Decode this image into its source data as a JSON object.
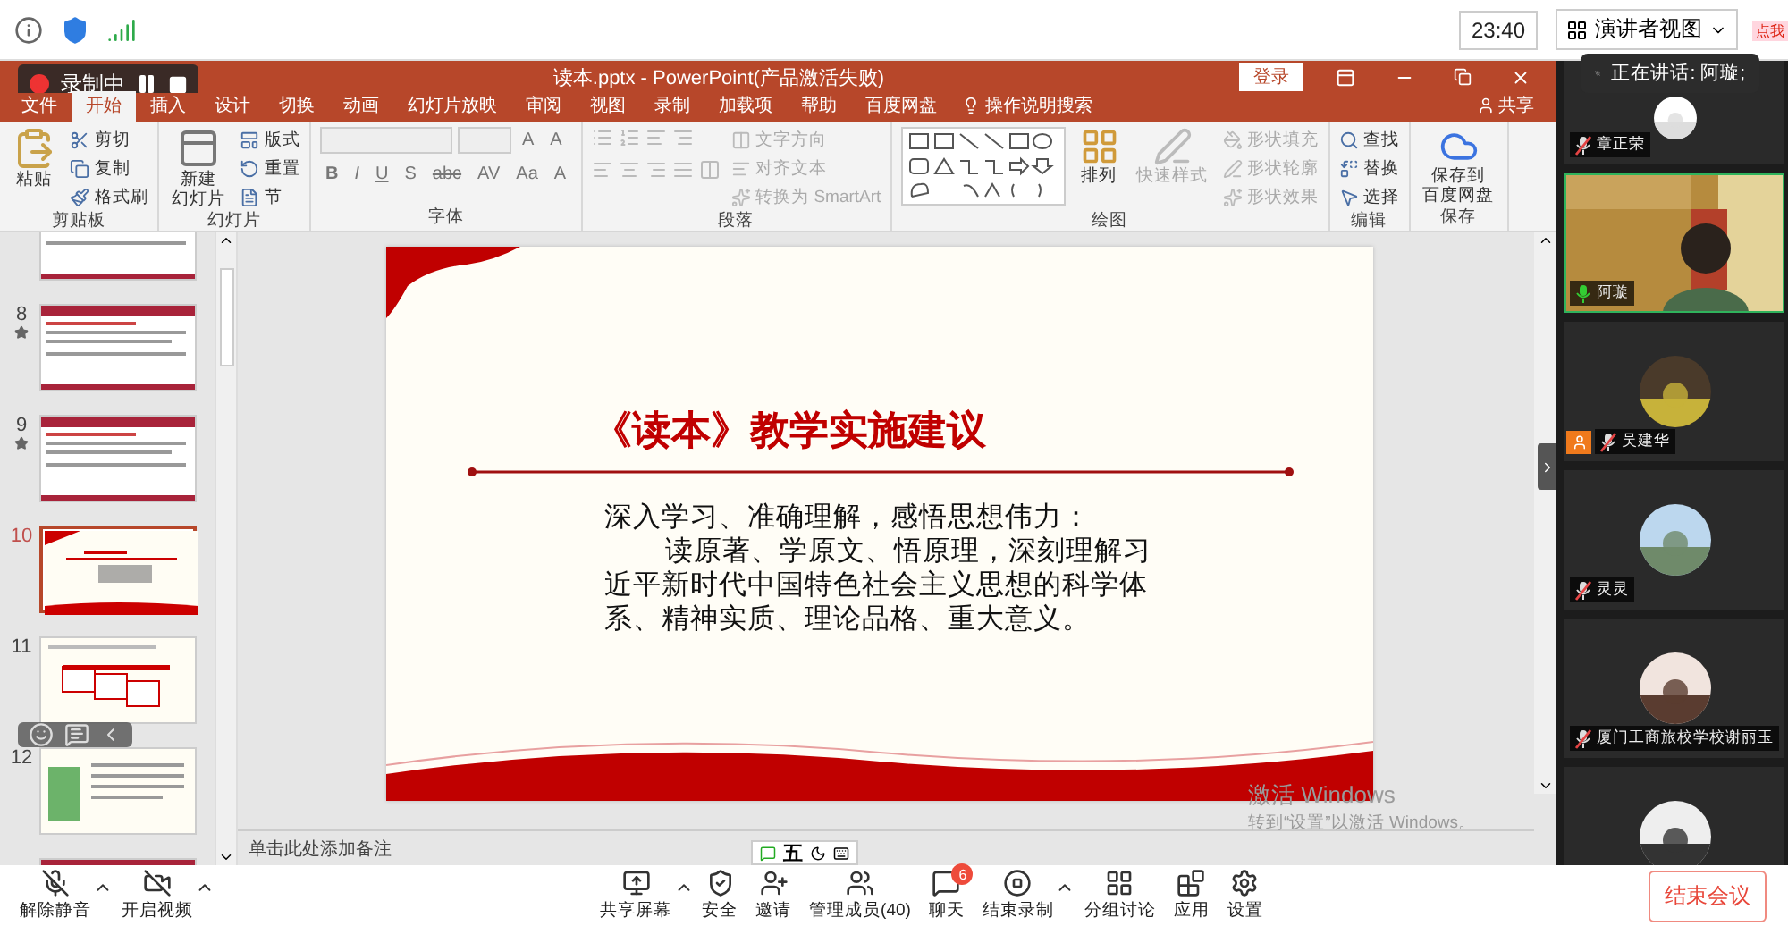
{
  "top_bar": {
    "time": "23:40",
    "view_button": "演讲者视图"
  },
  "speaking": {
    "label": "正在讲话: 阿璇;"
  },
  "sticker": "点我",
  "recording": {
    "label": "录制中"
  },
  "window": {
    "title": "读本.pptx  -  PowerPoint(产品激活失败)",
    "login_button": "登录"
  },
  "menu_tabs": [
    {
      "label": "文件",
      "selected": false
    },
    {
      "label": "开始",
      "selected": true
    },
    {
      "label": "插入",
      "selected": false
    },
    {
      "label": "设计",
      "selected": false
    },
    {
      "label": "切换",
      "selected": false
    },
    {
      "label": "动画",
      "selected": false
    },
    {
      "label": "幻灯片放映",
      "selected": false
    },
    {
      "label": "审阅",
      "selected": false
    },
    {
      "label": "视图",
      "selected": false
    },
    {
      "label": "录制",
      "selected": false
    },
    {
      "label": "加载项",
      "selected": false
    },
    {
      "label": "帮助",
      "selected": false
    },
    {
      "label": "百度网盘",
      "selected": false
    }
  ],
  "tell_me": "操作说明搜索",
  "share": "共享",
  "ribbon": {
    "groups": [
      {
        "title": "剪贴板",
        "kind": "standard",
        "items": [
          {
            "kind": "large",
            "lines": [
              "粘贴"
            ],
            "disabled": false
          },
          {
            "kind": "small",
            "label": "剪切",
            "disabled": false
          },
          {
            "kind": "small",
            "label": "复制",
            "disabled": false
          },
          {
            "kind": "small",
            "label": "格式刷",
            "disabled": false
          }
        ]
      },
      {
        "title": "幻灯片",
        "kind": "standard",
        "items": [
          {
            "kind": "large",
            "lines": [
              "新建",
              "幻灯片"
            ],
            "disabled": false
          },
          {
            "kind": "small",
            "label": "版式",
            "disabled": false
          },
          {
            "kind": "small",
            "label": "重置",
            "disabled": false
          },
          {
            "kind": "small",
            "label": "节",
            "disabled": false
          }
        ]
      },
      {
        "title": "字体",
        "kind": "font",
        "top_buttons": [
          "A",
          "A"
        ],
        "format_buttons": [
          "B",
          "I",
          "U",
          "S",
          "abc",
          "AV",
          "Aa",
          "A"
        ]
      },
      {
        "title": "段落",
        "kind": "paragraph",
        "items": [
          {
            "kind": "small",
            "label": "文字方向",
            "disabled": true
          },
          {
            "kind": "small",
            "label": "对齐文本",
            "disabled": true
          },
          {
            "kind": "small",
            "label": "转换为 SmartArt",
            "disabled": true
          }
        ]
      },
      {
        "title": "绘图",
        "kind": "drawing",
        "items": [
          {
            "kind": "large",
            "lines": [
              "排列"
            ],
            "disabled": false
          },
          {
            "kind": "large",
            "lines": [
              "快速样式"
            ],
            "disabled": true
          },
          {
            "kind": "small",
            "label": "形状填充",
            "disabled": true
          },
          {
            "kind": "small",
            "label": "形状轮廓",
            "disabled": true
          },
          {
            "kind": "small",
            "label": "形状效果",
            "disabled": true
          }
        ]
      },
      {
        "title": "编辑",
        "kind": "standard",
        "items": [
          {
            "kind": "small",
            "label": "查找",
            "disabled": false
          },
          {
            "kind": "small",
            "label": "替换",
            "disabled": false
          },
          {
            "kind": "small",
            "label": "选择",
            "disabled": false
          }
        ]
      },
      {
        "title": "保存",
        "kind": "standard",
        "items": [
          {
            "kind": "large",
            "lines": [
              "保存到",
              "百度网盘"
            ],
            "disabled": false
          }
        ]
      }
    ]
  },
  "thumbnails": [
    {
      "kind": "list",
      "starred": false,
      "selected": false
    },
    {
      "number": "8",
      "kind": "list",
      "starred": true,
      "selected": false
    },
    {
      "number": "9",
      "kind": "list",
      "starred": true,
      "selected": false
    },
    {
      "number": "10",
      "kind": "title",
      "starred": false,
      "selected": true
    },
    {
      "number": "11",
      "kind": "diagram",
      "starred": false,
      "selected": false
    },
    {
      "number": "12",
      "starred": false,
      "selected": false
    },
    {
      "kind": "list",
      "starred": false,
      "selected": false
    }
  ],
  "slide": {
    "title": "《读本》教学实施建议",
    "lead": "深入学习、准确理解，感悟思想伟力：",
    "body": "读原著、学原文、悟原理，深刻理解习近平新时代中国特色社会主义思想的科学体系、精神实质、理论品格、重大意义。"
  },
  "notes_placeholder": "单击此处添加备注",
  "activation": {
    "title": "激活 Windows",
    "hint": "转到“设置”以激活 Windows。"
  },
  "ime": {
    "label": "五"
  },
  "participants": [
    {
      "name": "章正荣",
      "kind": "avatar",
      "muted": true,
      "speaking": false,
      "host": false
    },
    {
      "name": "阿璇",
      "kind": "video",
      "muted": false,
      "speaking": true,
      "host": false
    },
    {
      "name": "吴建华",
      "kind": "avatar",
      "muted": true,
      "speaking": false,
      "host": true
    },
    {
      "name": "灵灵",
      "kind": "avatar",
      "muted": true,
      "speaking": false,
      "host": false
    },
    {
      "name": "厦门工商旅校学校谢丽玉",
      "kind": "avatar",
      "muted": true,
      "speaking": false,
      "host": false
    },
    {
      "kind": "avatar",
      "speaking": false,
      "host": false
    }
  ],
  "toolbar": {
    "left": [
      {
        "label": "解除静音",
        "kind": "mic_off",
        "caret": true
      },
      {
        "label": "开启视频",
        "kind": "video_off",
        "caret": true
      }
    ],
    "center": [
      {
        "label": "共享屏幕",
        "kind": "share",
        "caret": true
      },
      {
        "label": "安全",
        "kind": "security",
        "caret": false
      },
      {
        "label": "邀请",
        "kind": "invite",
        "caret": false
      },
      {
        "label": "管理成员(40)",
        "kind": "members",
        "caret": false
      },
      {
        "label": "聊天",
        "kind": "chat",
        "caret": false,
        "badge": "6"
      },
      {
        "label": "结束录制",
        "kind": "stop_record",
        "caret": true
      },
      {
        "label": "分组讨论",
        "kind": "breakout",
        "caret": false
      },
      {
        "label": "应用",
        "kind": "apps",
        "caret": false
      },
      {
        "label": "设置",
        "kind": "settings",
        "caret": false
      }
    ],
    "end_button": "结束会议"
  }
}
